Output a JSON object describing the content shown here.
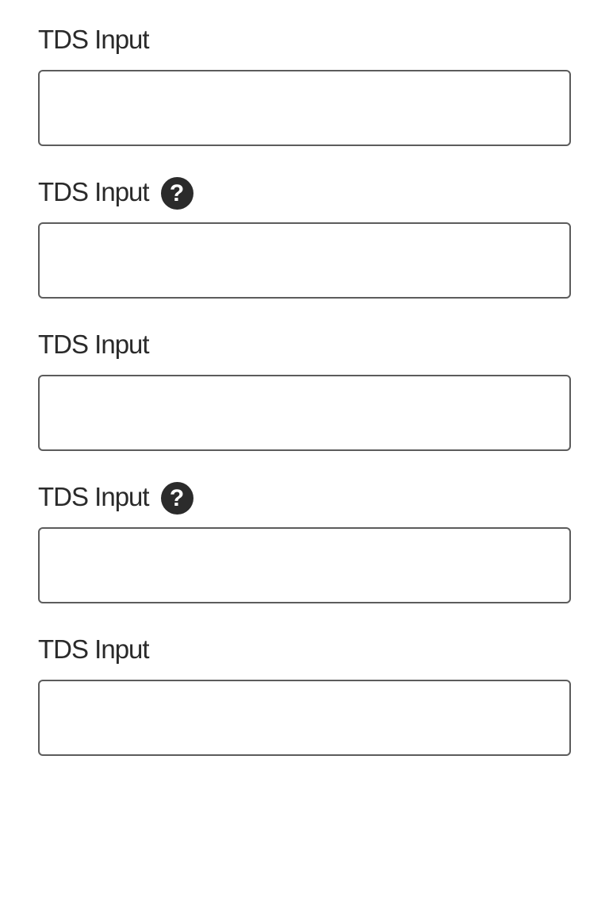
{
  "fields": [
    {
      "label": "TDS Input",
      "value": "",
      "has_help": false
    },
    {
      "label": "TDS Input",
      "value": "",
      "has_help": true,
      "help_icon": "question-circle-icon",
      "help_glyph": "?"
    },
    {
      "label": "TDS Input",
      "value": "",
      "has_help": false
    },
    {
      "label": "TDS Input",
      "value": "",
      "has_help": true,
      "help_icon": "question-circle-icon",
      "help_glyph": "?"
    },
    {
      "label": "TDS Input",
      "value": "",
      "has_help": false
    }
  ]
}
